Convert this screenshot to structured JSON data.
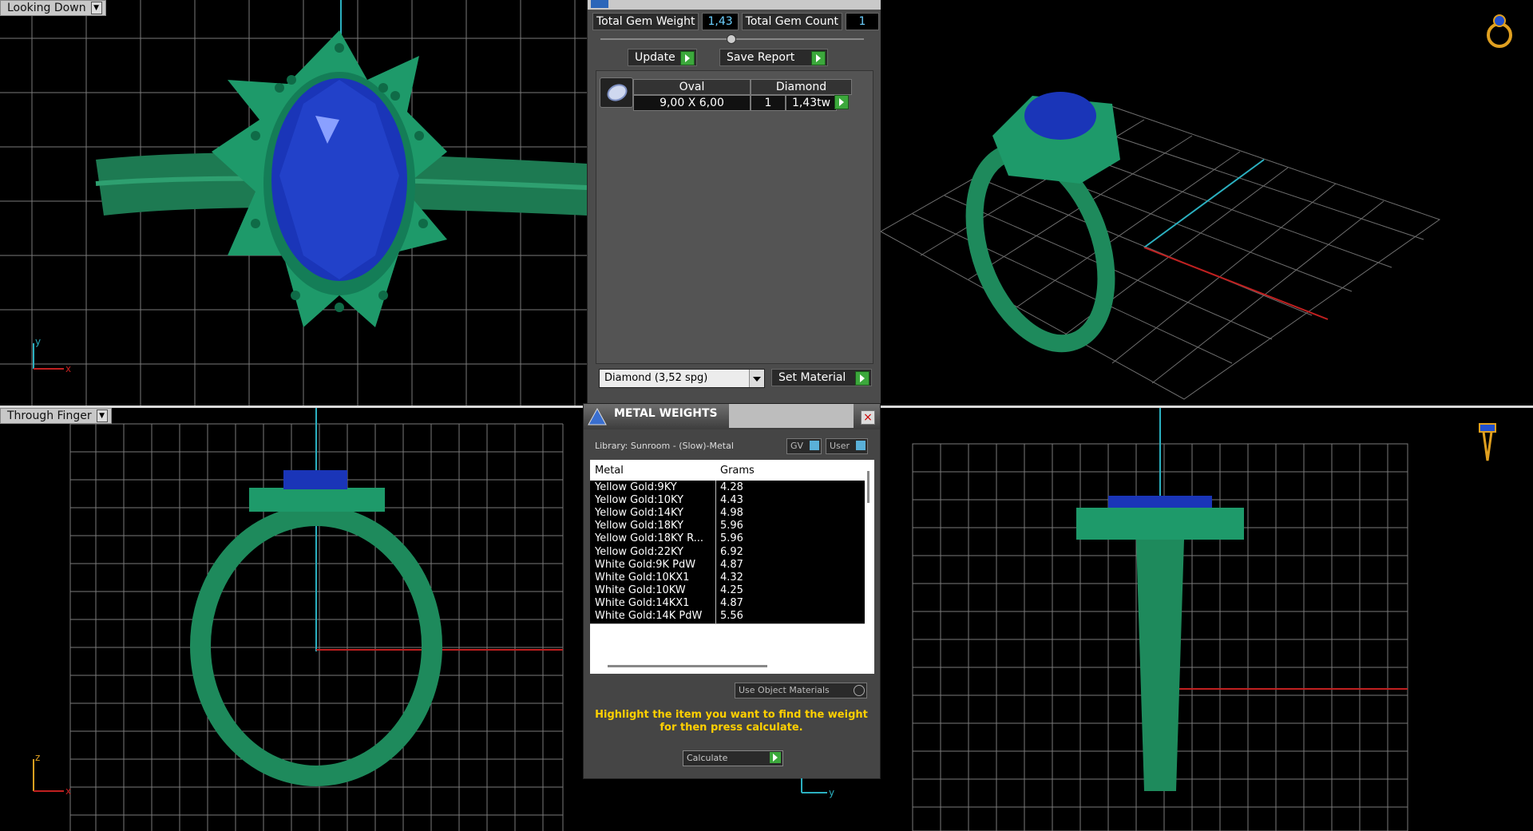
{
  "viewports": {
    "top_left": {
      "label": "Looking Down",
      "axis_x": "x",
      "axis_y": "y"
    },
    "bottom_left": {
      "label": "Through Finger",
      "axis_x": "x",
      "axis_y": "z"
    },
    "bottom_right": {
      "axis_y": "y"
    }
  },
  "gem_panel": {
    "total_weight_label": "Total Gem Weight",
    "total_weight_value": "1,43",
    "total_count_label": "Total Gem Count",
    "total_count_value": "1",
    "update_label": "Update",
    "save_report_label": "Save Report",
    "gem": {
      "shape_header": "Oval",
      "material_header": "Diamond",
      "size": "9,00 X 6,00",
      "count": "1",
      "weight": "1,43tw"
    },
    "material_select": "Diamond     (3,52 spg)",
    "set_material_label": "Set Material"
  },
  "metal_weights": {
    "title": "METAL WEIGHTS",
    "close": "×",
    "library": "Library: Sunroom - (Slow)-Metal",
    "gv_label": "GV",
    "user_label": "User",
    "columns": {
      "metal": "Metal",
      "grams": "Grams"
    },
    "rows": [
      {
        "metal": "Yellow Gold:9KY",
        "grams": "4.28"
      },
      {
        "metal": "Yellow Gold:10KY",
        "grams": "4.43"
      },
      {
        "metal": "Yellow Gold:14KY",
        "grams": "4.98"
      },
      {
        "metal": "Yellow Gold:18KY",
        "grams": "5.96"
      },
      {
        "metal": "Yellow Gold:18KY R...",
        "grams": "5.96"
      },
      {
        "metal": "Yellow Gold:22KY",
        "grams": "6.92"
      },
      {
        "metal": "White Gold:9K PdW",
        "grams": "4.87"
      },
      {
        "metal": "White Gold:10KX1",
        "grams": "4.32"
      },
      {
        "metal": "White Gold:10KW",
        "grams": "4.25"
      },
      {
        "metal": "White Gold:14KX1",
        "grams": "4.87"
      },
      {
        "metal": "White Gold:14K PdW",
        "grams": "5.56"
      }
    ],
    "use_object_materials": "Use Object Materials",
    "hint_line1": "Highlight the item you want to find the weight",
    "hint_line2": "for then press calculate.",
    "calculate_label": "Calculate"
  },
  "colors": {
    "metal": "#1e8a5c",
    "gem": "#1a2fb0",
    "grid": "#8a8a8a",
    "hint": "#ffd000",
    "go": "#3ca83c"
  }
}
